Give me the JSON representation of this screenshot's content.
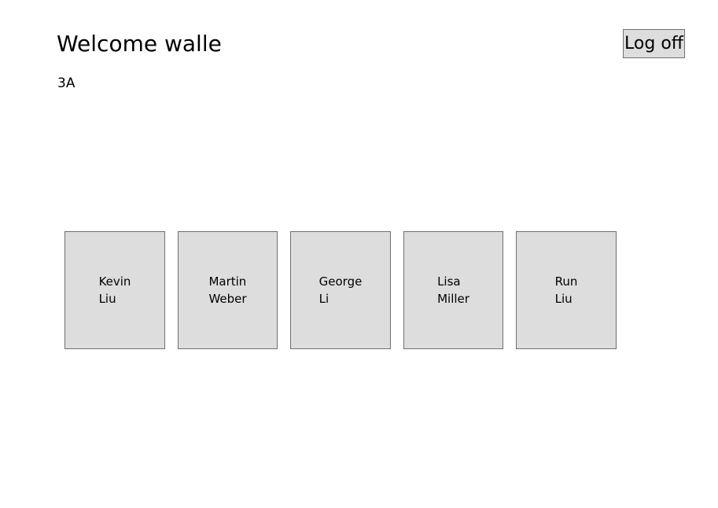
{
  "header": {
    "welcome": "Welcome walle",
    "class_name": "3A",
    "logoff_label": "Log off"
  },
  "students": [
    {
      "first": "Kevin",
      "last": "Liu"
    },
    {
      "first": "Martin",
      "last": "Weber"
    },
    {
      "first": "George",
      "last": "Li"
    },
    {
      "first": "Lisa",
      "last": "Miller"
    },
    {
      "first": "Run",
      "last": "Liu"
    }
  ],
  "colors": {
    "tile_background": "#dddddd",
    "tile_border": "#707070",
    "page_background": "#ffffff"
  }
}
